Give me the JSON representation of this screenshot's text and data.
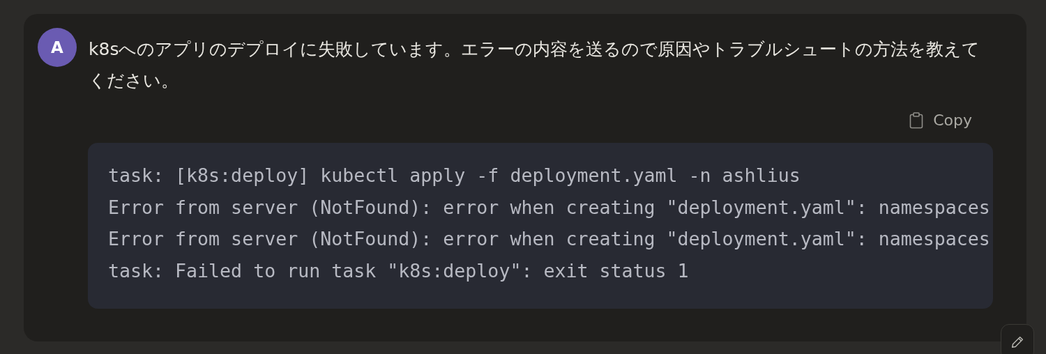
{
  "message": {
    "avatar": "A",
    "text": "k8sへのアプリのデプロイに失敗しています。エラーの内容を送るので原因やトラブルシュートの方法を教えてください。"
  },
  "code_block": {
    "copy_label": "Copy",
    "lines": [
      "task: [k8s:deploy] kubectl apply -f deployment.yaml -n ashlius",
      "Error from server (NotFound): error when creating \"deployment.yaml\": namespaces",
      "Error from server (NotFound): error when creating \"deployment.yaml\": namespaces",
      "task: Failed to run task \"k8s:deploy\": exit status 1"
    ]
  }
}
